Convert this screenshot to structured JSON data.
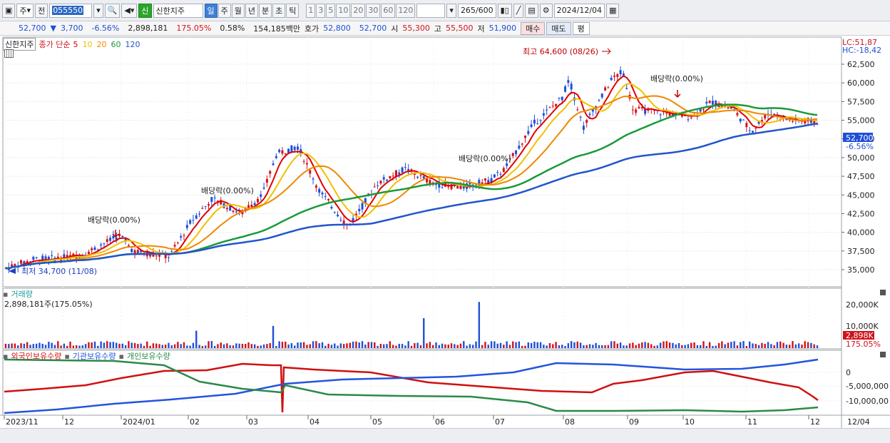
{
  "toolbar": {
    "market": "주",
    "prev": "전",
    "code": "055550",
    "badge": "신",
    "name": "신한지주",
    "periods": [
      "일",
      "주",
      "월",
      "년",
      "분",
      "초",
      "틱"
    ],
    "active_period": "일",
    "counts": [
      "1",
      "3",
      "5",
      "10",
      "20",
      "30",
      "60",
      "120"
    ],
    "range": "265",
    "range_total": "/600",
    "date": "2024/12/04"
  },
  "quote": {
    "price": "52,700",
    "arrow": "▼",
    "change": "3,700",
    "change_pct": "-6.56%",
    "volume": "2,898,181",
    "vol_ratio": "175.05%",
    "turnover": "0.58%",
    "amount": "154,185백만",
    "ask_label": "호가",
    "ask": "52,800",
    "bid": "52,700",
    "open_label": "시",
    "open": "55,300",
    "high_label": "고",
    "high": "55,500",
    "low_label": "저",
    "low": "51,900",
    "buy_btn": "매수",
    "sell_btn": "매도",
    "eval_btn": "평"
  },
  "legend": {
    "stock": "신한지주",
    "ma_title": "종가 단순",
    "ma": [
      {
        "label": "5",
        "color": "#e00000"
      },
      {
        "label": "10",
        "color": "#f0c000"
      },
      {
        "label": "20",
        "color": "#ee8800"
      },
      {
        "label": "60",
        "color": "#1a9a3a"
      },
      {
        "label": "120",
        "color": "#2255cc"
      }
    ]
  },
  "price_panel": {
    "lc": "LC:51,87",
    "hc": "HC:-18,42",
    "y_ticks": [
      "62,500",
      "60,000",
      "57,500",
      "55,000",
      "52,500",
      "50,000",
      "47,500",
      "45,000",
      "42,500",
      "40,000",
      "37,500",
      "35,000"
    ],
    "last_price": "52,700",
    "last_pct": "-6.56%",
    "annotations": [
      {
        "text": "최고 64,600 (08/26)",
        "color": "#c00000"
      },
      {
        "text": "최저 34,700 (11/08)",
        "color": "#1e3fbf"
      },
      {
        "text": "배당락(0.00%)"
      },
      {
        "text": "배당락(0.00%)"
      },
      {
        "text": "배당락(0.00%)"
      },
      {
        "text": "배당락(0.00%)"
      }
    ]
  },
  "volume_panel": {
    "title": "거래량",
    "value": "2,898,181주(175.05%)",
    "y_ticks": [
      "20,000K",
      "10,000K"
    ],
    "last": "2,898K",
    "last_pct": "175.05%"
  },
  "holdings_panel": {
    "series": [
      {
        "label": "외국인보유수량",
        "color": "#d01010"
      },
      {
        "label": "기관보유수량",
        "color": "#2255dd"
      },
      {
        "label": "개인보유수량",
        "color": "#2a8a4a"
      }
    ],
    "y_ticks": [
      "0",
      "-5,000,000",
      "-10,000,00"
    ]
  },
  "x_axis": [
    "2023/11",
    "12",
    "2024/01",
    "02",
    "03",
    "04",
    "05",
    "06",
    "07",
    "08",
    "09",
    "10",
    "11",
    "12"
  ],
  "x_right": "12/04",
  "colors": {
    "up": "#d0121b",
    "down": "#1e4fd8",
    "accent": "#3d7fd6"
  }
}
